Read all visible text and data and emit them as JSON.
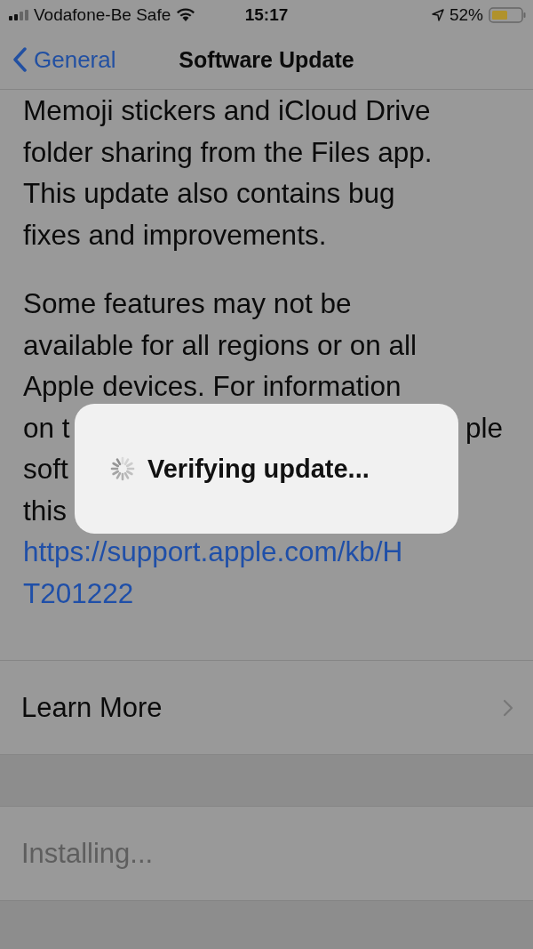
{
  "status_bar": {
    "carrier": "Vodafone-Be Safe",
    "time": "15:17",
    "battery": "52%"
  },
  "nav": {
    "back": "General",
    "title": "Software Update"
  },
  "paragraphs": [
    {
      "lines": [
        {
          "text": "Memoji stickers and iCloud Drive"
        },
        {
          "text": "folder sharing from the Files app."
        },
        {
          "text": "This update also contains bug"
        },
        {
          "text": "fixes and improvements."
        }
      ]
    },
    {
      "lines": [
        {
          "text": "Some features may not be"
        },
        {
          "text": "available for all regions or on all"
        },
        {
          "text": "Apple devices. For information"
        },
        {
          "text": "on t",
          "end_text": "ple"
        },
        {
          "text": "soft"
        },
        {
          "text": "this"
        }
      ],
      "link_lines": [
        "https://support.apple.com/kb/H",
        "T201222"
      ]
    }
  ],
  "rows": [
    {
      "label": "Learn More",
      "kind": "navigation",
      "disabled": false
    },
    {
      "label": "Installing...",
      "kind": "status",
      "disabled": true
    }
  ],
  "dialog": {
    "text": "Verifying update..."
  }
}
